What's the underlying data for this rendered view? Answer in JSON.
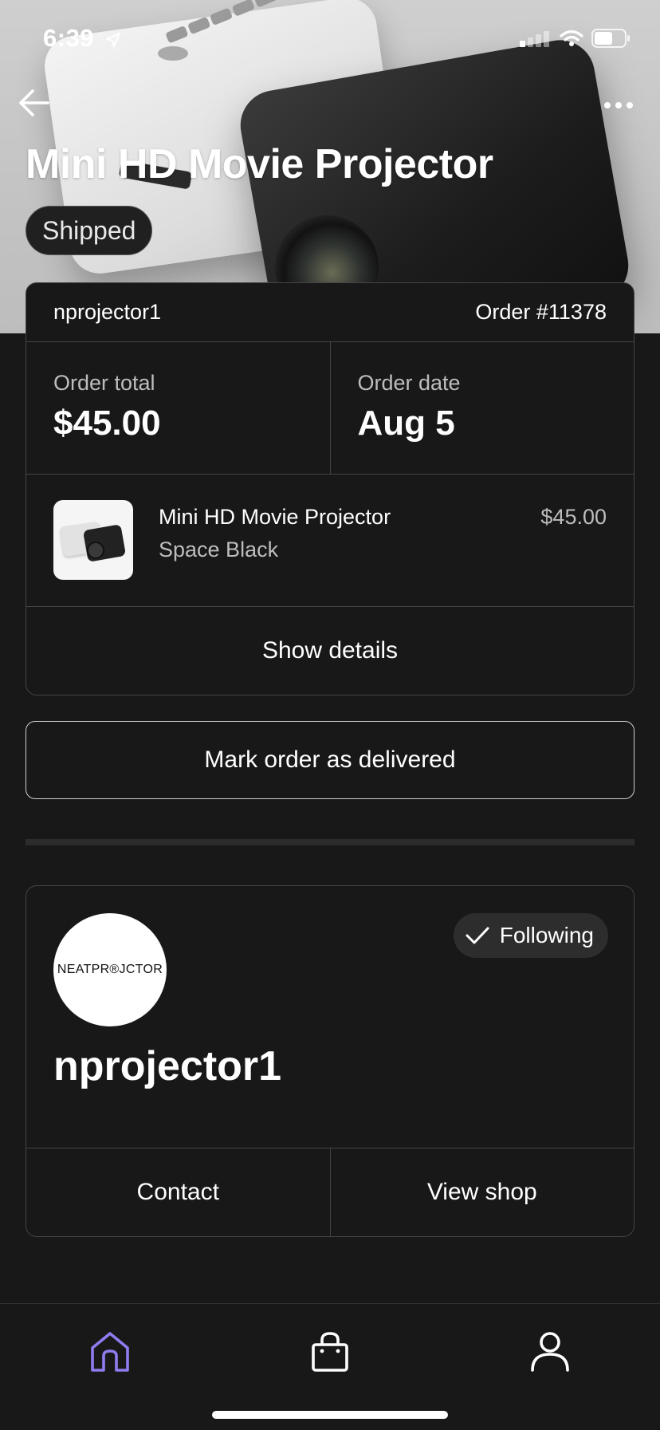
{
  "status_bar": {
    "time": "6:39"
  },
  "header": {
    "title": "Mini HD Movie Projector",
    "status_badge": "Shipped"
  },
  "order": {
    "shop_username": "nprojector1",
    "order_number": "Order #11378",
    "total_label": "Order total",
    "total_value": "$45.00",
    "date_label": "Order date",
    "date_value": "Aug 5",
    "item": {
      "name": "Mini HD Movie Projector",
      "variant": "Space Black",
      "price": "$45.00"
    },
    "show_details_label": "Show details"
  },
  "mark_delivered_label": "Mark order as delivered",
  "shop": {
    "logo_text": "NEATPR®JCTOR",
    "following_label": "Following",
    "name": "nprojector1",
    "contact_label": "Contact",
    "view_shop_label": "View shop"
  },
  "tabbar": {
    "items": [
      {
        "icon": "home-icon",
        "active": true
      },
      {
        "icon": "shopping-bag-icon",
        "active": false
      },
      {
        "icon": "profile-icon",
        "active": false
      }
    ],
    "active_color": "#8f7cf0"
  },
  "colors": {
    "background": "#181818",
    "border": "#444444",
    "badge_bg": "#202020",
    "pill_bg": "#2d2d2d"
  }
}
